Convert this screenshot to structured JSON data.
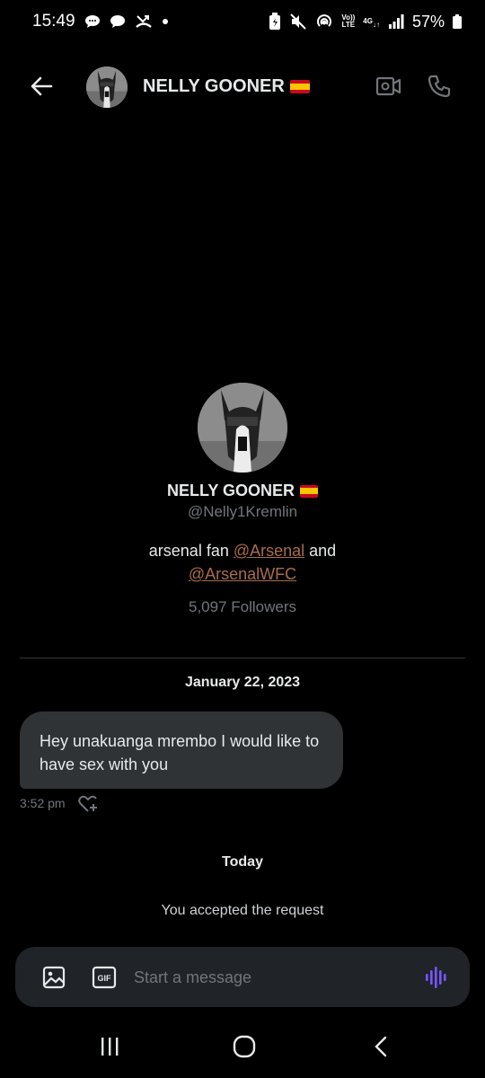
{
  "status_bar": {
    "time": "15:49",
    "battery": "57%",
    "network": "4G",
    "volte": "Vo)) LTE"
  },
  "header": {
    "contact_name": "NELLY GOONER",
    "flag": "spain-flag"
  },
  "profile": {
    "name": "NELLY GOONER",
    "handle": "@Nelly1Kremlin",
    "bio_prefix": "arsenal fan ",
    "bio_mention_1": "@Arsenal",
    "bio_joiner": " and",
    "bio_mention_2": "@ArsenalWFC",
    "followers": "5,097 Followers"
  },
  "conversation": {
    "date_separator": "January 22, 2023",
    "messages": [
      {
        "text": "Hey unakuanga mrembo I would like to have sex with you",
        "time": "3:52 pm"
      }
    ],
    "today_separator": "Today",
    "system_notice": "You accepted the request"
  },
  "composer": {
    "placeholder": "Start a message",
    "gif_label": "GIF"
  },
  "colors": {
    "background": "#000000",
    "bubble": "#2f3336",
    "mention": "#a86c4a",
    "voice_accent": "#7856ff"
  }
}
